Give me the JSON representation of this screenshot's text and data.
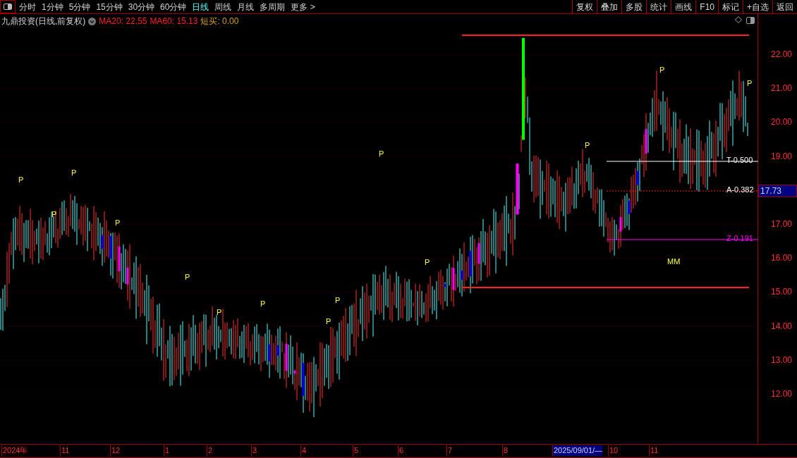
{
  "periods": [
    {
      "label": "分时",
      "selected": false
    },
    {
      "label": "1分钟",
      "selected": false
    },
    {
      "label": "5分钟",
      "selected": false
    },
    {
      "label": "15分钟",
      "selected": false
    },
    {
      "label": "30分钟",
      "selected": false
    },
    {
      "label": "60分钟",
      "selected": false
    },
    {
      "label": "日线",
      "selected": true
    },
    {
      "label": "周线",
      "selected": false
    },
    {
      "label": "月线",
      "selected": false
    },
    {
      "label": "多周期",
      "selected": false
    },
    {
      "label": "更多 >",
      "selected": false
    }
  ],
  "actions": [
    "复权",
    "叠加",
    "多股",
    "统计",
    "画线",
    "F10",
    "标记",
    "+自选",
    "返回"
  ],
  "legend": {
    "title": "九鼎投资(日线,前复权)",
    "items": [
      {
        "text": "MA20: 22.55",
        "color": "#ff2020"
      },
      {
        "text": "MA60: 15.13",
        "color": "#ff2020"
      },
      {
        "text": "短买: 0.00",
        "color": "#d4a017"
      }
    ]
  },
  "y_ticks": [
    "22.00",
    "21.00",
    "20.00",
    "19.00",
    "17.00",
    "16.00",
    "15.00",
    "14.00",
    "13.00",
    "12.00"
  ],
  "current_price": "17.73",
  "levels": [
    {
      "label": "T-0.500",
      "color": "#ffffff"
    },
    {
      "label": "A-0.382",
      "color": "#ffffff"
    },
    {
      "label": "Z-0.191",
      "color": "#ff00ff"
    }
  ],
  "p_markers": [
    "P",
    "P",
    "P",
    "P",
    "P",
    "P",
    "P",
    "P",
    "P",
    "P",
    "P",
    "P",
    "P",
    "P"
  ],
  "mm_marker": "MM",
  "x_labels": [
    {
      "text": "2024年",
      "selected": false
    },
    {
      "text": "11",
      "selected": false
    },
    {
      "text": "12",
      "selected": false
    },
    {
      "text": "1",
      "selected": false
    },
    {
      "text": "2",
      "selected": false
    },
    {
      "text": "3",
      "selected": false
    },
    {
      "text": "4",
      "selected": false
    },
    {
      "text": "5",
      "selected": false
    },
    {
      "text": "6",
      "selected": false
    },
    {
      "text": "7",
      "selected": false
    },
    {
      "text": "8",
      "selected": false
    },
    {
      "text": "2025/09/01/—",
      "selected": true
    },
    {
      "text": "10",
      "selected": false
    },
    {
      "text": "11",
      "selected": false
    }
  ]
}
